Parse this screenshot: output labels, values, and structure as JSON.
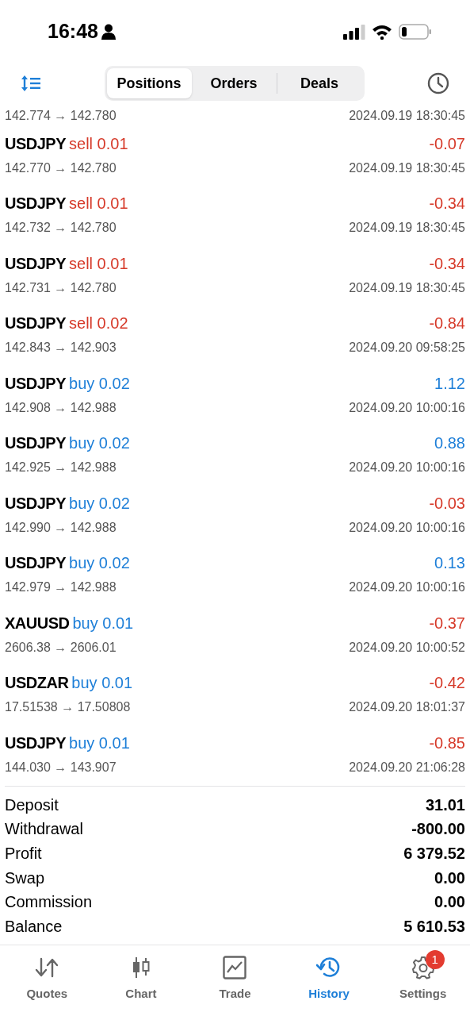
{
  "status_bar": {
    "time": "16:48"
  },
  "header": {
    "tabs": [
      {
        "label": "Positions",
        "selected": true
      },
      {
        "label": "Orders",
        "selected": false
      },
      {
        "label": "Deals",
        "selected": false
      }
    ]
  },
  "partial_row": {
    "prices": "142.774 → 142.780",
    "time": "2024.09.19 18:30:45"
  },
  "deals": [
    {
      "symbol": "USDJPY",
      "side": "sell",
      "lot": "0.01",
      "prices": "142.770 → 142.780",
      "profit": "-0.07",
      "loss": true,
      "time": "2024.09.19 18:30:45"
    },
    {
      "symbol": "USDJPY",
      "side": "sell",
      "lot": "0.01",
      "prices": "142.732 → 142.780",
      "profit": "-0.34",
      "loss": true,
      "time": "2024.09.19 18:30:45"
    },
    {
      "symbol": "USDJPY",
      "side": "sell",
      "lot": "0.01",
      "prices": "142.731 → 142.780",
      "profit": "-0.34",
      "loss": true,
      "time": "2024.09.19 18:30:45"
    },
    {
      "symbol": "USDJPY",
      "side": "sell",
      "lot": "0.02",
      "prices": "142.843 → 142.903",
      "profit": "-0.84",
      "loss": true,
      "time": "2024.09.20 09:58:25"
    },
    {
      "symbol": "USDJPY",
      "side": "buy",
      "lot": "0.02",
      "prices": "142.908 → 142.988",
      "profit": "1.12",
      "loss": false,
      "time": "2024.09.20 10:00:16"
    },
    {
      "symbol": "USDJPY",
      "side": "buy",
      "lot": "0.02",
      "prices": "142.925 → 142.988",
      "profit": "0.88",
      "loss": false,
      "time": "2024.09.20 10:00:16"
    },
    {
      "symbol": "USDJPY",
      "side": "buy",
      "lot": "0.02",
      "prices": "142.990 → 142.988",
      "profit": "-0.03",
      "loss": true,
      "time": "2024.09.20 10:00:16"
    },
    {
      "symbol": "USDJPY",
      "side": "buy",
      "lot": "0.02",
      "prices": "142.979 → 142.988",
      "profit": "0.13",
      "loss": false,
      "time": "2024.09.20 10:00:16"
    },
    {
      "symbol": "XAUUSD",
      "side": "buy",
      "lot": "0.01",
      "prices": "2606.38 → 2606.01",
      "profit": "-0.37",
      "loss": true,
      "time": "2024.09.20 10:00:52"
    },
    {
      "symbol": "USDZAR",
      "side": "buy",
      "lot": "0.01",
      "prices": "17.51538 → 17.50808",
      "profit": "-0.42",
      "loss": true,
      "time": "2024.09.20 18:01:37"
    },
    {
      "symbol": "USDJPY",
      "side": "buy",
      "lot": "0.01",
      "prices": "144.030 → 143.907",
      "profit": "-0.85",
      "loss": true,
      "time": "2024.09.20 21:06:28"
    }
  ],
  "summary": [
    {
      "label": "Deposit",
      "value": "31.01"
    },
    {
      "label": "Withdrawal",
      "value": "-800.00"
    },
    {
      "label": "Profit",
      "value": "6 379.52"
    },
    {
      "label": "Swap",
      "value": "0.00"
    },
    {
      "label": "Commission",
      "value": "0.00"
    },
    {
      "label": "Balance",
      "value": "5 610.53"
    }
  ],
  "tab_bar": [
    {
      "kind": "quotes",
      "label": "Quotes",
      "selected": false
    },
    {
      "kind": "chart",
      "label": "Chart",
      "selected": false
    },
    {
      "kind": "trade",
      "label": "Trade",
      "selected": false
    },
    {
      "kind": "history",
      "label": "History",
      "selected": true
    },
    {
      "kind": "settings",
      "label": "Settings",
      "selected": false,
      "badge": "1"
    }
  ]
}
